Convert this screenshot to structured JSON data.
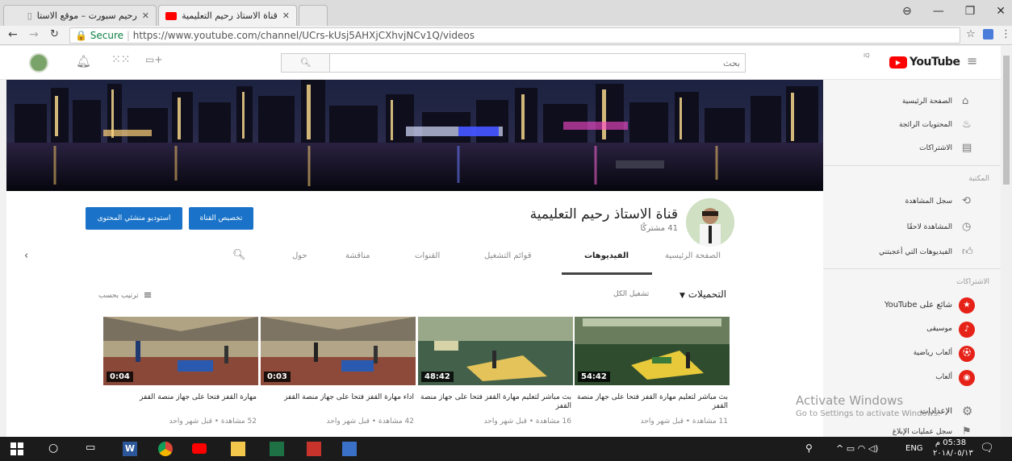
{
  "browser": {
    "tabs": [
      {
        "title": "قناة الاستاذ رحيم التعليمية",
        "active": true
      },
      {
        "title": "رحيم سبورت – موقع الاستا",
        "active": false
      }
    ],
    "url_secure_label": "Secure",
    "url": "https://www.youtube.com/channel/UCrs-kUsj5AHXjCXhvjNCv1Q/videos"
  },
  "masthead": {
    "logo_text": "YouTube",
    "country_code": "IQ",
    "search_placeholder": "بحث"
  },
  "channel": {
    "name": "قناة الاستاذ رحيم التعليمية",
    "subscribers": "41 مشتركًا",
    "customize_button": "تخصيص القناة",
    "studio_button": "استوديو منشئي المحتوى",
    "tabs": [
      "الصفحة الرئيسية",
      "الفيديوهات",
      "قوائم التشغيل",
      "القنوات",
      "مناقشة",
      "حول"
    ],
    "active_tab": "الفيديوهات"
  },
  "uploads": {
    "heading": "التحميلات",
    "play_all": "تشغيل الكل",
    "sort_by": "ترتيب بحسب"
  },
  "videos": [
    {
      "duration": "54:42",
      "title": "بث مباشر لتعليم مهارة القفز فتحا على جهاز منصة القفز",
      "meta": "11 مشاهدة • قبل شهر واحد"
    },
    {
      "duration": "48:42",
      "title": "بث مباشر لتعليم مهارة القفز فتحا على جهاز منصة القفز",
      "meta": "16 مشاهدة • قبل شهر واحد"
    },
    {
      "duration": "0:03",
      "title": "اداء مهارة القفز فتحا على جهاز منصة القفز",
      "meta": "42 مشاهدة • قبل شهر واحد"
    },
    {
      "duration": "0:04",
      "title": "مهارة القفز فتحا على جهاز منصة القفز",
      "meta": "52 مشاهدة • قبل شهر واحد"
    }
  ],
  "sidebar": {
    "main": [
      "الصفحة الرئيسية",
      "المحتويات الرائجة",
      "الاشتراكات"
    ],
    "library_heading": "المكتبة",
    "library": [
      "سجل المشاهدة",
      "المشاهدة لاحقًا",
      "الفيديوهات التي أعجبتني"
    ],
    "subs_heading": "الاشتراكات",
    "subs": [
      "شائع على YouTube",
      "موسيقى",
      "ألعاب رياضية",
      "ألعاب"
    ],
    "settings": "الإعدادات",
    "report": "سجل عمليات الإبلاغ"
  },
  "watermark": {
    "line1": "Activate Windows",
    "line2": "Go to Settings to activate Windows."
  },
  "taskbar": {
    "time": "05:38 م",
    "date": "٢٠١٨/٠٥/١٣",
    "lang": "ENG"
  },
  "colors": {
    "accent": "#1a73c8",
    "youtube_red": "#ff0000"
  }
}
